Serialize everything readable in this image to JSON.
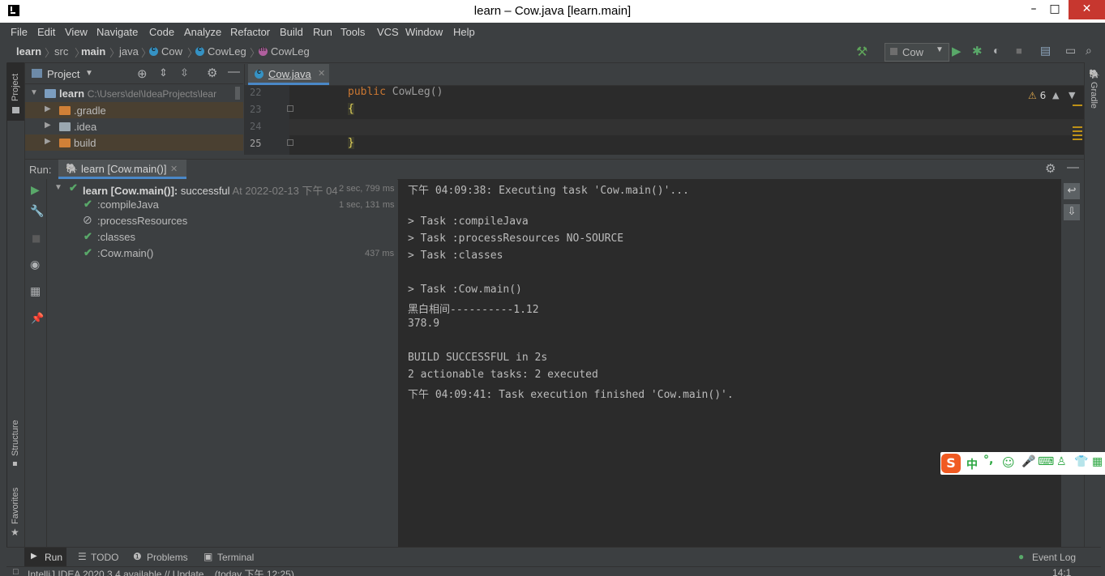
{
  "window": {
    "title": "learn – Cow.java [learn.main]",
    "minimize": "–",
    "maximize": "□",
    "close": "✕"
  },
  "menu": [
    "File",
    "Edit",
    "View",
    "Navigate",
    "Code",
    "Analyze",
    "Refactor",
    "Build",
    "Run",
    "Tools",
    "VCS",
    "Window",
    "Help"
  ],
  "breadcrumbs": {
    "b0": "learn",
    "b1": "src",
    "b2": "main",
    "b3": "java",
    "b4": "Cow",
    "b5": "CowLeg",
    "b6": "CowLeg"
  },
  "toolbar": {
    "run_config": "Cow"
  },
  "project": {
    "header": "Project",
    "root_name": "learn",
    "root_path": "C:\\Users\\del\\IdeaProjects\\lear",
    "items": [
      ".gradle",
      ".idea",
      "build"
    ]
  },
  "editor": {
    "tab_label": "Cow.java",
    "warnings": "6",
    "lines": [
      {
        "num": "22",
        "code_kw": "public ",
        "code_name": "CowLeg()"
      },
      {
        "num": "23",
        "code": "{"
      },
      {
        "num": "24",
        "code": ""
      },
      {
        "num": "25",
        "code": "}"
      }
    ]
  },
  "left_stripe": {
    "project": "Project",
    "structure": "Structure",
    "favorites": "Favorites"
  },
  "right_stripe": {
    "gradle": "Gradle"
  },
  "run": {
    "label": "Run:",
    "tab": "learn [Cow.main()]",
    "tree": [
      {
        "name": "learn [Cow.main()]:",
        "status": " successful",
        "detail": " At 2022-02-13 下午 04",
        "time": "2 sec, 799 ms"
      },
      {
        "name": ":compileJava",
        "time": "1 sec, 131 ms"
      },
      {
        "name": ":processResources",
        "time": ""
      },
      {
        "name": ":classes",
        "time": ""
      },
      {
        "name": ":Cow.main()",
        "time": "437 ms"
      }
    ],
    "console": [
      "下午 04:09:38: Executing task 'Cow.main()'...",
      "",
      "> Task :compileJava",
      "> Task :processResources NO-SOURCE",
      "> Task :classes",
      "",
      "> Task :Cow.main()",
      "黑白相间----------1.12",
      "378.9",
      "",
      "BUILD SUCCESSFUL in 2s",
      "2 actionable tasks: 2 executed",
      "下午 04:09:41: Task execution finished 'Cow.main()'."
    ]
  },
  "bottom_tabs": {
    "run": "Run",
    "todo": "TODO",
    "problems": "Problems",
    "terminal": "Terminal",
    "event_log": "Event Log"
  },
  "status": {
    "message": "IntelliJ IDEA 2020.3.4 available // Update... (today 下午 12:25)",
    "position": "14:1"
  },
  "ime": {
    "mode": "中"
  }
}
